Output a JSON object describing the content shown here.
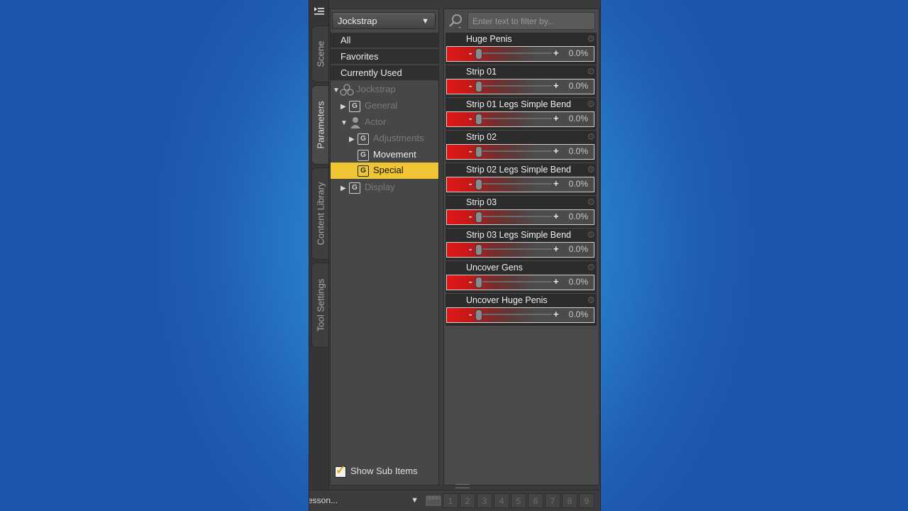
{
  "tabs": [
    {
      "label": "Scene"
    },
    {
      "label": "Parameters"
    },
    {
      "label": "Content Library"
    },
    {
      "label": "Tool Settings"
    }
  ],
  "left_panel": {
    "dropdown_value": "Jockstrap",
    "quick_items": [
      "All",
      "Favorites",
      "Currently Used"
    ],
    "tree": {
      "root": "Jockstrap",
      "general": "General",
      "actor": "Actor",
      "adjustments": "Adjustments",
      "movement": "Movement",
      "special": "Special",
      "display": "Display",
      "group_glyph": "G"
    },
    "show_sub_items": {
      "label": "Show Sub Items",
      "checked": true
    }
  },
  "right_panel": {
    "search_placeholder": "Enter text to filter by...",
    "params": [
      {
        "name": "Huge Penis",
        "value": "0.0%"
      },
      {
        "name": "Strip 01",
        "value": "0.0%"
      },
      {
        "name": "Strip 01 Legs Simple Bend",
        "value": "0.0%"
      },
      {
        "name": "Strip 02",
        "value": "0.0%"
      },
      {
        "name": "Strip 02 Legs Simple Bend",
        "value": "0.0%"
      },
      {
        "name": "Strip 03",
        "value": "0.0%"
      },
      {
        "name": "Strip 03 Legs Simple Bend",
        "value": "0.0%"
      },
      {
        "name": "Uncover Gens",
        "value": "0.0%"
      },
      {
        "name": "Uncover Huge Penis",
        "value": "0.0%"
      }
    ]
  },
  "bottom_bar": {
    "lesson_label": "esson...",
    "numbers": [
      "1",
      "2",
      "3",
      "4",
      "5",
      "6",
      "7",
      "8",
      "9"
    ]
  },
  "colors": {
    "selection": "#f0c534",
    "slider_red": "#e01818",
    "panel_bg": "#474747"
  },
  "icons": {
    "menu": "menu-icon",
    "search": "search-icon",
    "gear": "gear-icon",
    "figure": "figure-icon",
    "actor": "actor-icon",
    "clapboard": "clapboard-icon"
  }
}
